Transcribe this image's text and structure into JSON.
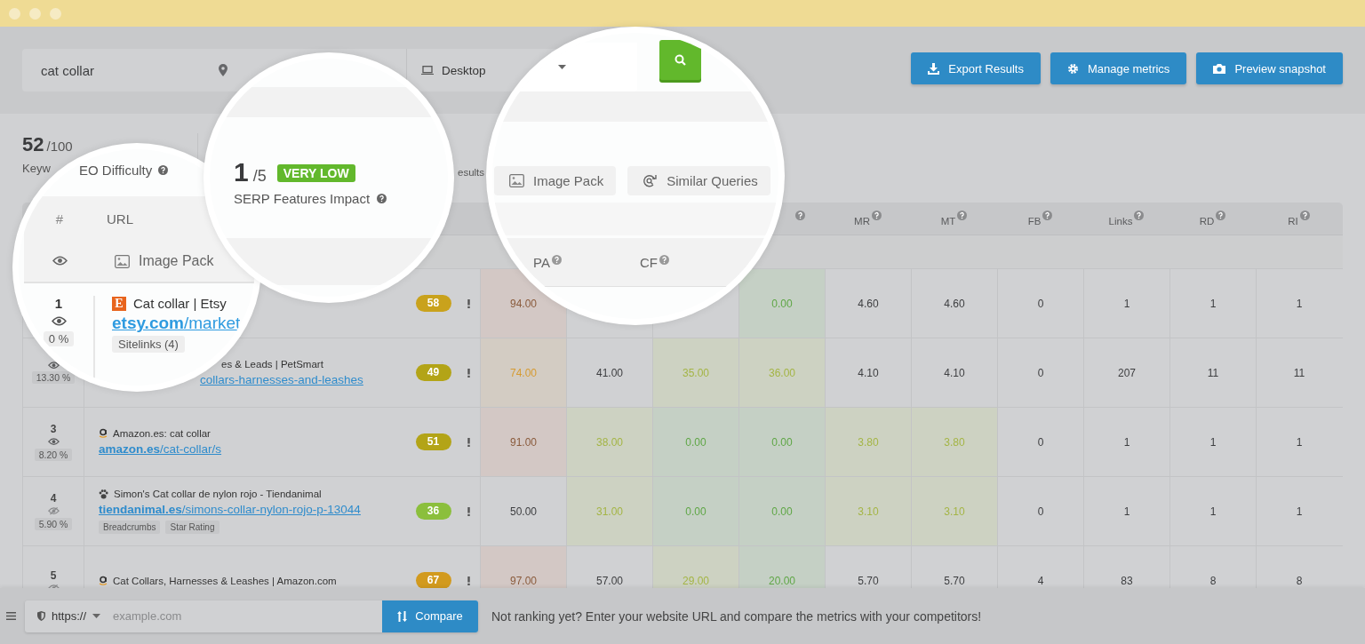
{
  "search": {
    "keyword": "cat collar",
    "device": "Desktop"
  },
  "actions": [
    {
      "label": "Export Results"
    },
    {
      "label": "Manage metrics"
    },
    {
      "label": "Preview snapshot"
    }
  ],
  "stats": {
    "score": "52",
    "max": "/100",
    "label": "Keyw",
    "other_label": "esults"
  },
  "table": {
    "columns": [
      {},
      {},
      {},
      {
        "help": true
      },
      {
        "label": "MR",
        "help": true
      },
      {
        "label": "MT",
        "help": true
      },
      {
        "label": "FB",
        "help": true
      },
      {
        "label": "Links",
        "help": true
      },
      {
        "label": "RD",
        "help": true
      },
      {
        "label": "RI",
        "help": true
      }
    ],
    "rows": [
      {
        "score": "58",
        "color": "#c9a21c",
        "cells": [
          {
            "value": "94.00",
            "color": "#d3c8c5"
          },
          {
            "color": "#d0d1d3"
          },
          {
            "color": "#d0d1d3"
          },
          {
            "value": "0.00",
            "color": "#c5d0c5"
          },
          {
            "value": "4.60",
            "color": "#d0d1d3"
          },
          {
            "value": "4.60",
            "color": "#d0d1d3"
          },
          {
            "value": "0",
            "color": "#d0d1d3"
          },
          {
            "value": "1",
            "color": "#d0d1d3"
          },
          {
            "value": "1",
            "color": "#d0d1d3"
          },
          {
            "value": "1",
            "color": "#d0d1d3"
          }
        ]
      },
      {
        "hidden": false,
        "share": "13.30 %",
        "partly_covered": true,
        "title": "es & Leads | PetSmart",
        "path": "collars-harnesses-and-leashes",
        "score": "49",
        "color": "#b3a417",
        "cells": [
          {
            "value": "74.00",
            "color": "#d3ccc3"
          },
          {
            "value": "41.00",
            "color": "#d0d1d3"
          },
          {
            "value": "35.00",
            "color": "#cdd2c2"
          },
          {
            "value": "36.00",
            "color": "#cdd2c2"
          },
          {
            "value": "4.10",
            "color": "#d0d1d3"
          },
          {
            "value": "4.10",
            "color": "#d0d1d3"
          },
          {
            "value": "0",
            "color": "#d0d1d3"
          },
          {
            "value": "207",
            "color": "#d0d1d3"
          },
          {
            "value": "11",
            "color": "#d0d1d3"
          },
          {
            "value": "11",
            "color": "#d0d1d3"
          }
        ]
      },
      {
        "rank": "3",
        "hidden": false,
        "share": "8.20 %",
        "kind": "amazon",
        "title": "Amazon.es: cat collar",
        "domain": "amazon.es",
        "path": "/cat-collar/s",
        "score": "51",
        "color": "#b3a417",
        "cells": [
          {
            "value": "91.00",
            "color": "#d3c8c5"
          },
          {
            "value": "38.00",
            "color": "#cdd2c2"
          },
          {
            "value": "0.00",
            "color": "#c5d0c5"
          },
          {
            "value": "0.00",
            "color": "#c5d0c5"
          },
          {
            "value": "3.80",
            "color": "#cdd2c2"
          },
          {
            "value": "3.80",
            "color": "#cdd2c2"
          },
          {
            "value": "0",
            "color": "#d0d1d3"
          },
          {
            "value": "1",
            "color": "#d0d1d3"
          },
          {
            "value": "1",
            "color": "#d0d1d3"
          },
          {
            "value": "1",
            "color": "#d0d1d3"
          }
        ]
      },
      {
        "rank": "4",
        "hidden": true,
        "share": "5.90 %",
        "kind": "paw",
        "title": "Simon's Cat collar de nylon rojo - Tiendanimal",
        "domain": "tiendanimal.es",
        "path": "/simons-collar-nylon-rojo-p-13044",
        "tags": [
          "Breadcrumbs",
          "Star Rating"
        ],
        "score": "36",
        "color": "#8bbf3c",
        "cells": [
          {
            "value": "50.00",
            "color": "#d0d1d3"
          },
          {
            "value": "31.00",
            "color": "#cdd2c2"
          },
          {
            "value": "0.00",
            "color": "#c5d0c5"
          },
          {
            "value": "0.00",
            "color": "#c5d0c5"
          },
          {
            "value": "3.10",
            "color": "#cdd2c2"
          },
          {
            "value": "3.10",
            "color": "#cdd2c2"
          },
          {
            "value": "0",
            "color": "#d0d1d3"
          },
          {
            "value": "1",
            "color": "#d0d1d3"
          },
          {
            "value": "1",
            "color": "#d0d1d3"
          },
          {
            "value": "1",
            "color": "#d0d1d3"
          }
        ]
      },
      {
        "rank": "5",
        "hidden": true,
        "kind": "amazon",
        "title": "Cat Collars, Harnesses & Leashes | Amazon.com",
        "score": "67",
        "color": "#d29a1e",
        "cells": [
          {
            "value": "97.00",
            "color": "#d3c8c5"
          },
          {
            "value": "57.00",
            "color": "#d0d1d3"
          },
          {
            "value": "29.00",
            "color": "#cdd2c2"
          },
          {
            "value": "20.00",
            "color": "#c5d0c5"
          },
          {
            "value": "5.70",
            "color": "#d0d1d3"
          },
          {
            "value": "5.70",
            "color": "#d0d1d3"
          },
          {
            "value": "4",
            "color": "#d0d1d3"
          },
          {
            "value": "83",
            "color": "#d0d1d3"
          },
          {
            "value": "8",
            "color": "#d0d1d3"
          },
          {
            "value": "8",
            "color": "#d0d1d3"
          }
        ]
      }
    ]
  },
  "magnifiers": [
    {
      "kind": "results",
      "heading": "EO Difficulty",
      "columns": [
        "#",
        "URL"
      ],
      "feature": "Image Pack",
      "row": {
        "rank": "1",
        "hidden": false,
        "share": "0 %",
        "favicon_letter": "E",
        "title": "Cat collar | Etsy",
        "domain": "etsy.com",
        "path": "/market",
        "tags": [
          "Sitelinks (4)"
        ]
      }
    },
    {
      "kind": "impact",
      "score": "1",
      "max": "/5",
      "level_label": "VERY LOW",
      "label": "SERP Features Impact"
    },
    {
      "kind": "features",
      "features": [
        {
          "label": "Image Pack"
        },
        {
          "label": "Similar Queries"
        }
      ],
      "columns": [
        "PA",
        "CF"
      ]
    }
  ],
  "compare": {
    "protocol": "https://",
    "placeholder": "example.com",
    "button": "Compare",
    "message": "Not ranking yet? Enter your website URL and compare the metrics with your competitors!"
  }
}
